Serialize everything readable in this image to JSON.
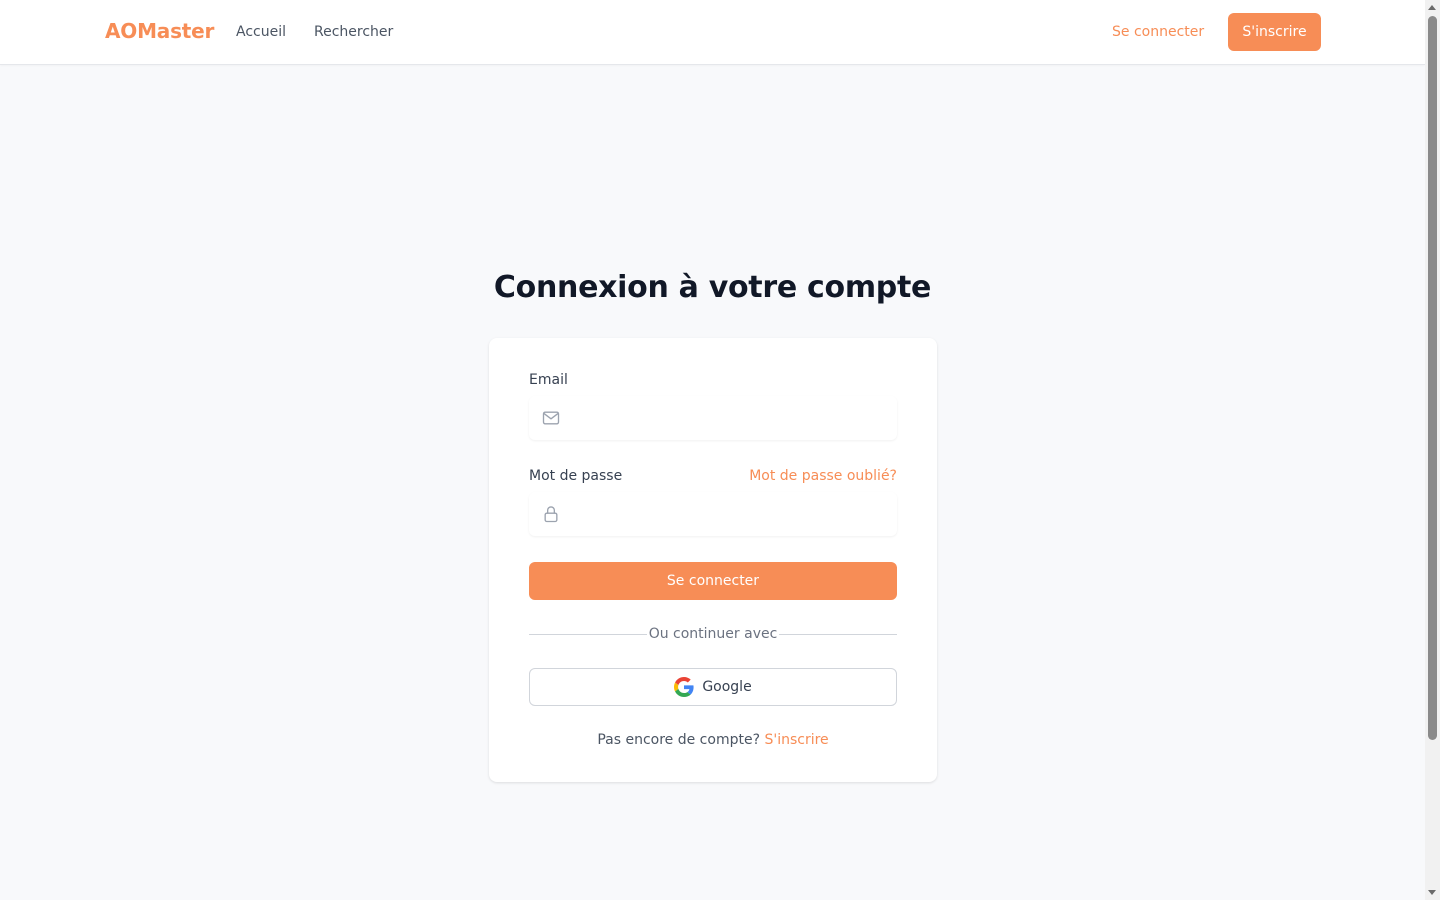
{
  "header": {
    "logo": "AOMaster",
    "nav": [
      {
        "label": "Accueil"
      },
      {
        "label": "Rechercher"
      }
    ],
    "login_label": "Se connecter",
    "signup_label": "S'inscrire"
  },
  "main": {
    "title": "Connexion à votre compte",
    "form": {
      "email_label": "Email",
      "email_value": "",
      "email_icon": "mail-icon",
      "password_label": "Mot de passe",
      "password_value": "",
      "password_icon": "lock-icon",
      "forgot_label": "Mot de passe oublié?",
      "submit_label": "Se connecter",
      "divider_text": "Ou continuer avec",
      "google_label": "Google",
      "google_icon": "google-icon",
      "no_account_text": "Pas encore de compte?",
      "signup_link": "S'inscrire"
    }
  },
  "colors": {
    "accent": "#f78d56",
    "background": "#f8f9fb",
    "title": "#111827"
  }
}
